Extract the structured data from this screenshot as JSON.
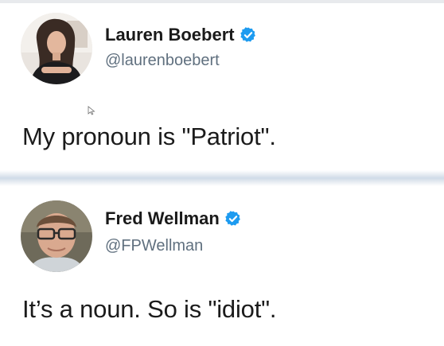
{
  "tweets": [
    {
      "display_name": "Lauren Boebert",
      "handle": "@laurenboebert",
      "verified": true,
      "text": "My pronoun is \"Patriot\"."
    },
    {
      "display_name": "Fred Wellman",
      "handle": "@FPWellman",
      "verified": true,
      "text": "It’s a noun. So is \"idiot\"."
    }
  ],
  "colors": {
    "verified_badge": "#1d9bf0",
    "handle_text": "#60707f",
    "divider": "#cfdbe8"
  },
  "icons": {
    "verified": "verified-badge-icon",
    "cursor": "mouse-pointer-icon"
  }
}
